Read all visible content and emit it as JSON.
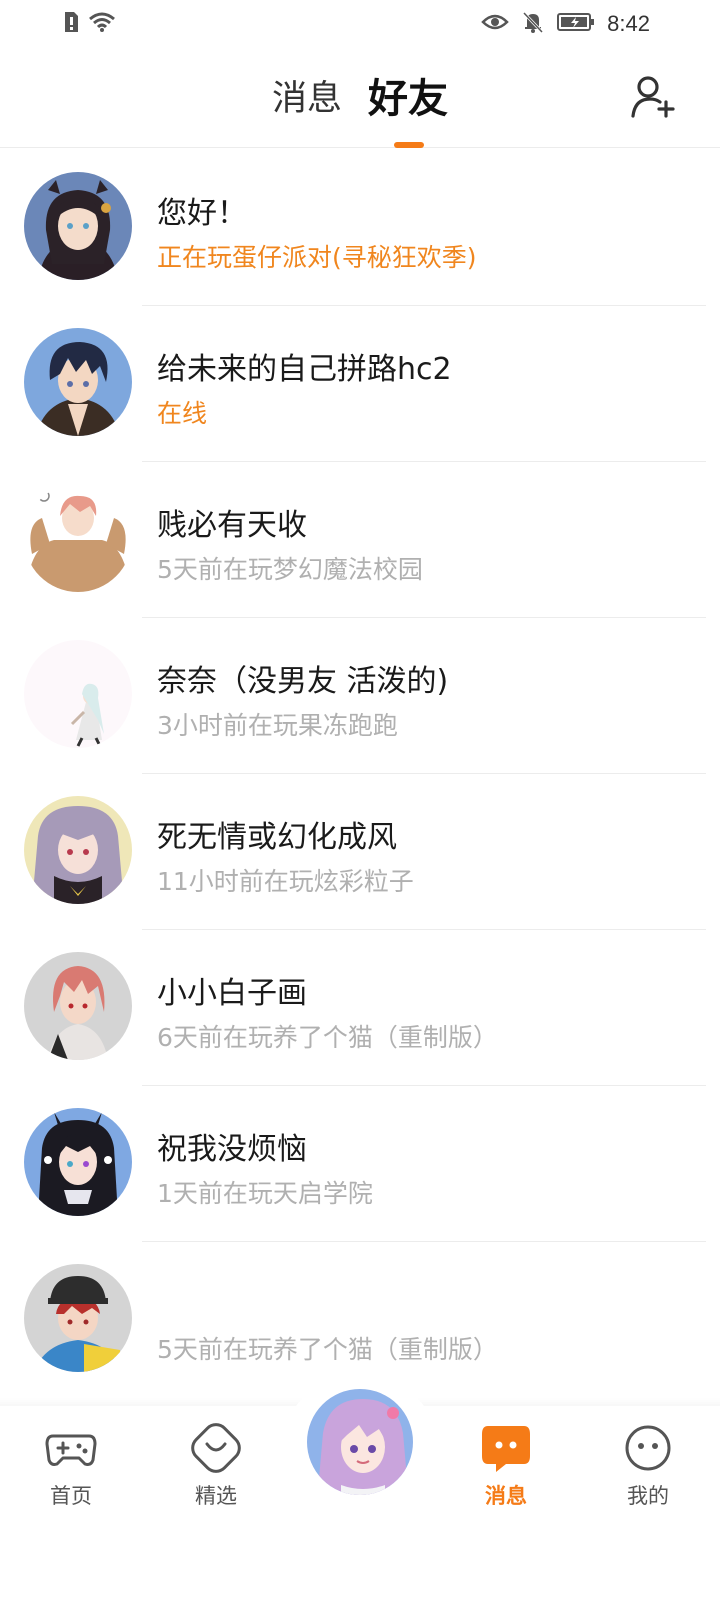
{
  "status_bar": {
    "time": "8:42",
    "icons": [
      "sim-alert-icon",
      "wifi-icon",
      "eye-icon",
      "mute-bell-icon",
      "battery-charging-icon"
    ]
  },
  "header": {
    "tabs": [
      {
        "label": "消息",
        "active": false
      },
      {
        "label": "好友",
        "active": true
      }
    ],
    "add_friend_icon": "add-person-icon",
    "accent_color": "#f57b17"
  },
  "friends": [
    {
      "name": "您好！",
      "status": "正在玩蛋仔派对(寻秘狂欢季)",
      "status_active": true
    },
    {
      "name": "给未来的自己拼路hc2",
      "status": "在线",
      "status_active": true
    },
    {
      "name": "贱必有天收",
      "status": "5天前在玩梦幻魔法校园",
      "status_active": false
    },
    {
      "name": "奈奈（没男友 活泼的)",
      "status": "3小时前在玩果冻跑跑",
      "status_active": false
    },
    {
      "name": "死无情或幻化成风",
      "status": "11小时前在玩炫彩粒子",
      "status_active": false
    },
    {
      "name": "小小白子画",
      "status": "6天前在玩养了个猫（重制版）",
      "status_active": false
    },
    {
      "name": "祝我没烦恼",
      "status": "1天前在玩天启学院",
      "status_active": false
    },
    {
      "name": "",
      "status": "5天前在玩养了个猫（重制版）",
      "status_active": false
    }
  ],
  "bottom_nav": {
    "items": [
      {
        "label": "首页",
        "icon": "gamepad-icon",
        "active": false
      },
      {
        "label": "精选",
        "icon": "heart-badge-icon",
        "active": false
      },
      {
        "label": "消息",
        "icon": "chat-bubble-icon",
        "active": true
      },
      {
        "label": "我的",
        "icon": "face-icon",
        "active": false
      }
    ],
    "center_icon": "user-avatar"
  },
  "colors": {
    "accent": "#f57b17",
    "active_status": "#f0861e",
    "inactive_status": "#b0b0b0",
    "divider": "#ececec"
  }
}
